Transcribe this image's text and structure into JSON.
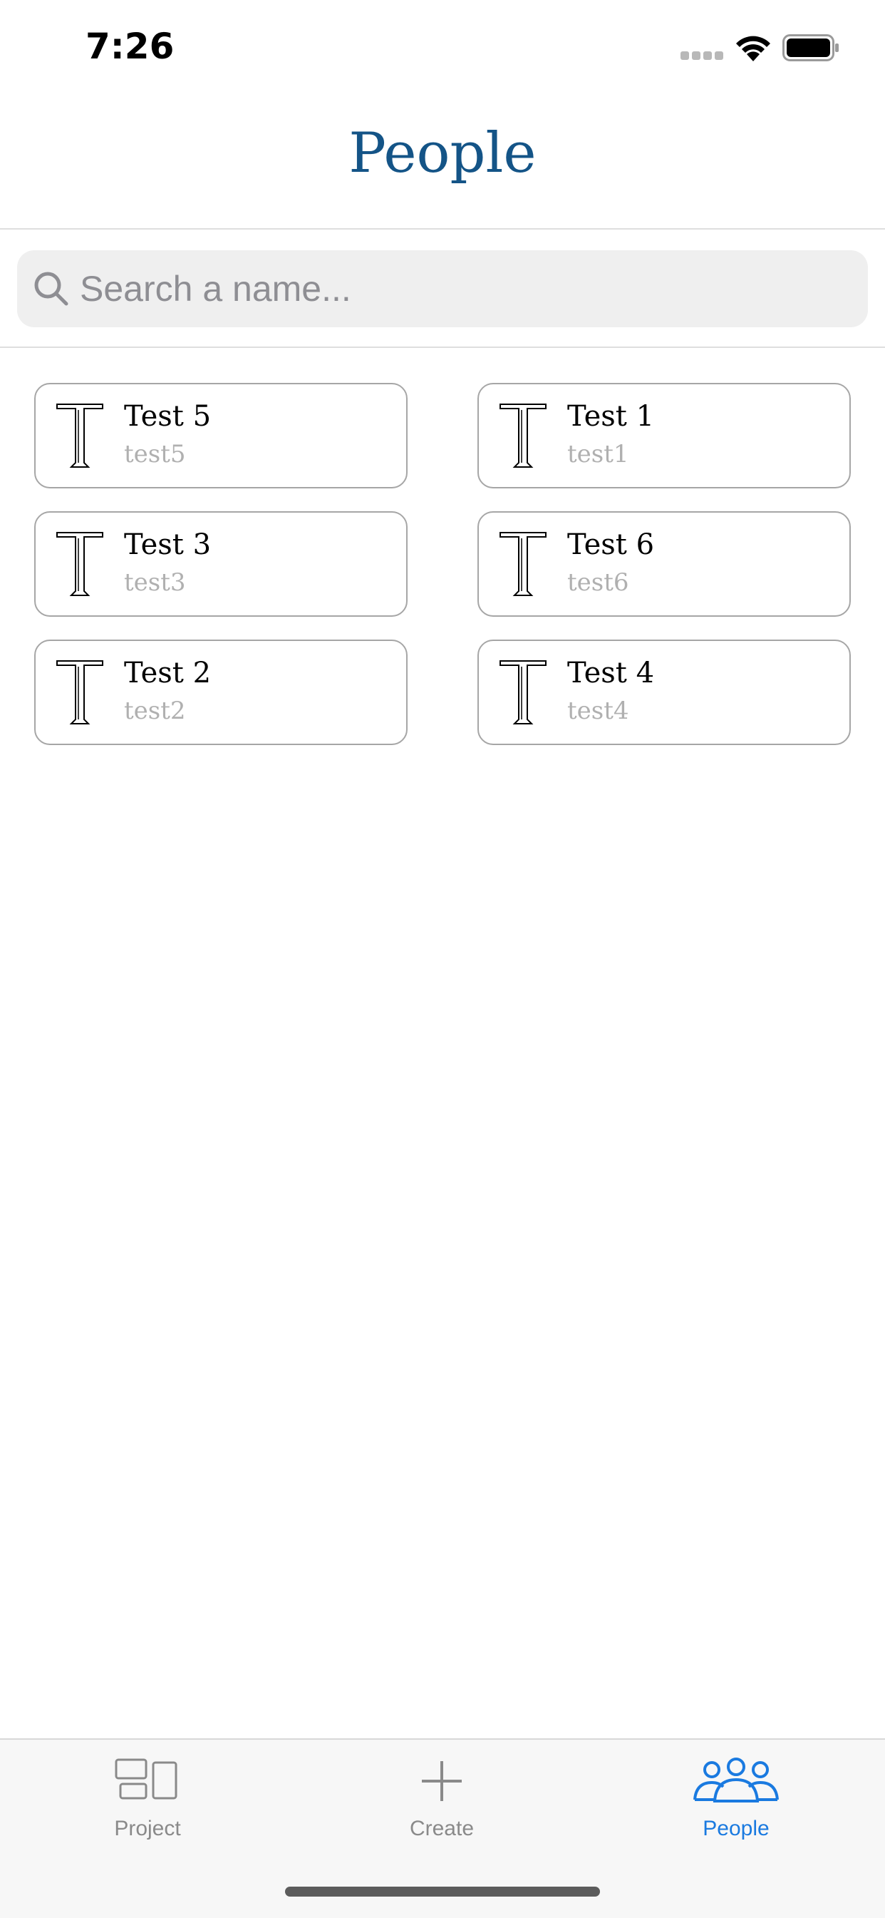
{
  "status_bar": {
    "time": "7:26"
  },
  "header": {
    "title": "People"
  },
  "search": {
    "placeholder": "Search a name...",
    "value": ""
  },
  "people": [
    {
      "name": "Test 5",
      "username": "test5",
      "avatar_letter": "T"
    },
    {
      "name": "Test 1",
      "username": "test1",
      "avatar_letter": "T"
    },
    {
      "name": "Test 3",
      "username": "test3",
      "avatar_letter": "T"
    },
    {
      "name": "Test 6",
      "username": "test6",
      "avatar_letter": "T"
    },
    {
      "name": "Test 2",
      "username": "test2",
      "avatar_letter": "T"
    },
    {
      "name": "Test 4",
      "username": "test4",
      "avatar_letter": "T"
    }
  ],
  "tab_bar": {
    "tabs": [
      {
        "label": "Project",
        "icon": "project-icon",
        "selected": false
      },
      {
        "label": "Create",
        "icon": "plus-icon",
        "selected": false
      },
      {
        "label": "People",
        "icon": "people-icon",
        "selected": true
      }
    ]
  },
  "colors": {
    "title": "#145487",
    "active_tab": "#1a7ae0",
    "inactive_tab": "#8a8a8a",
    "card_border": "#a6a6a6",
    "username": "#b0b0b0"
  }
}
